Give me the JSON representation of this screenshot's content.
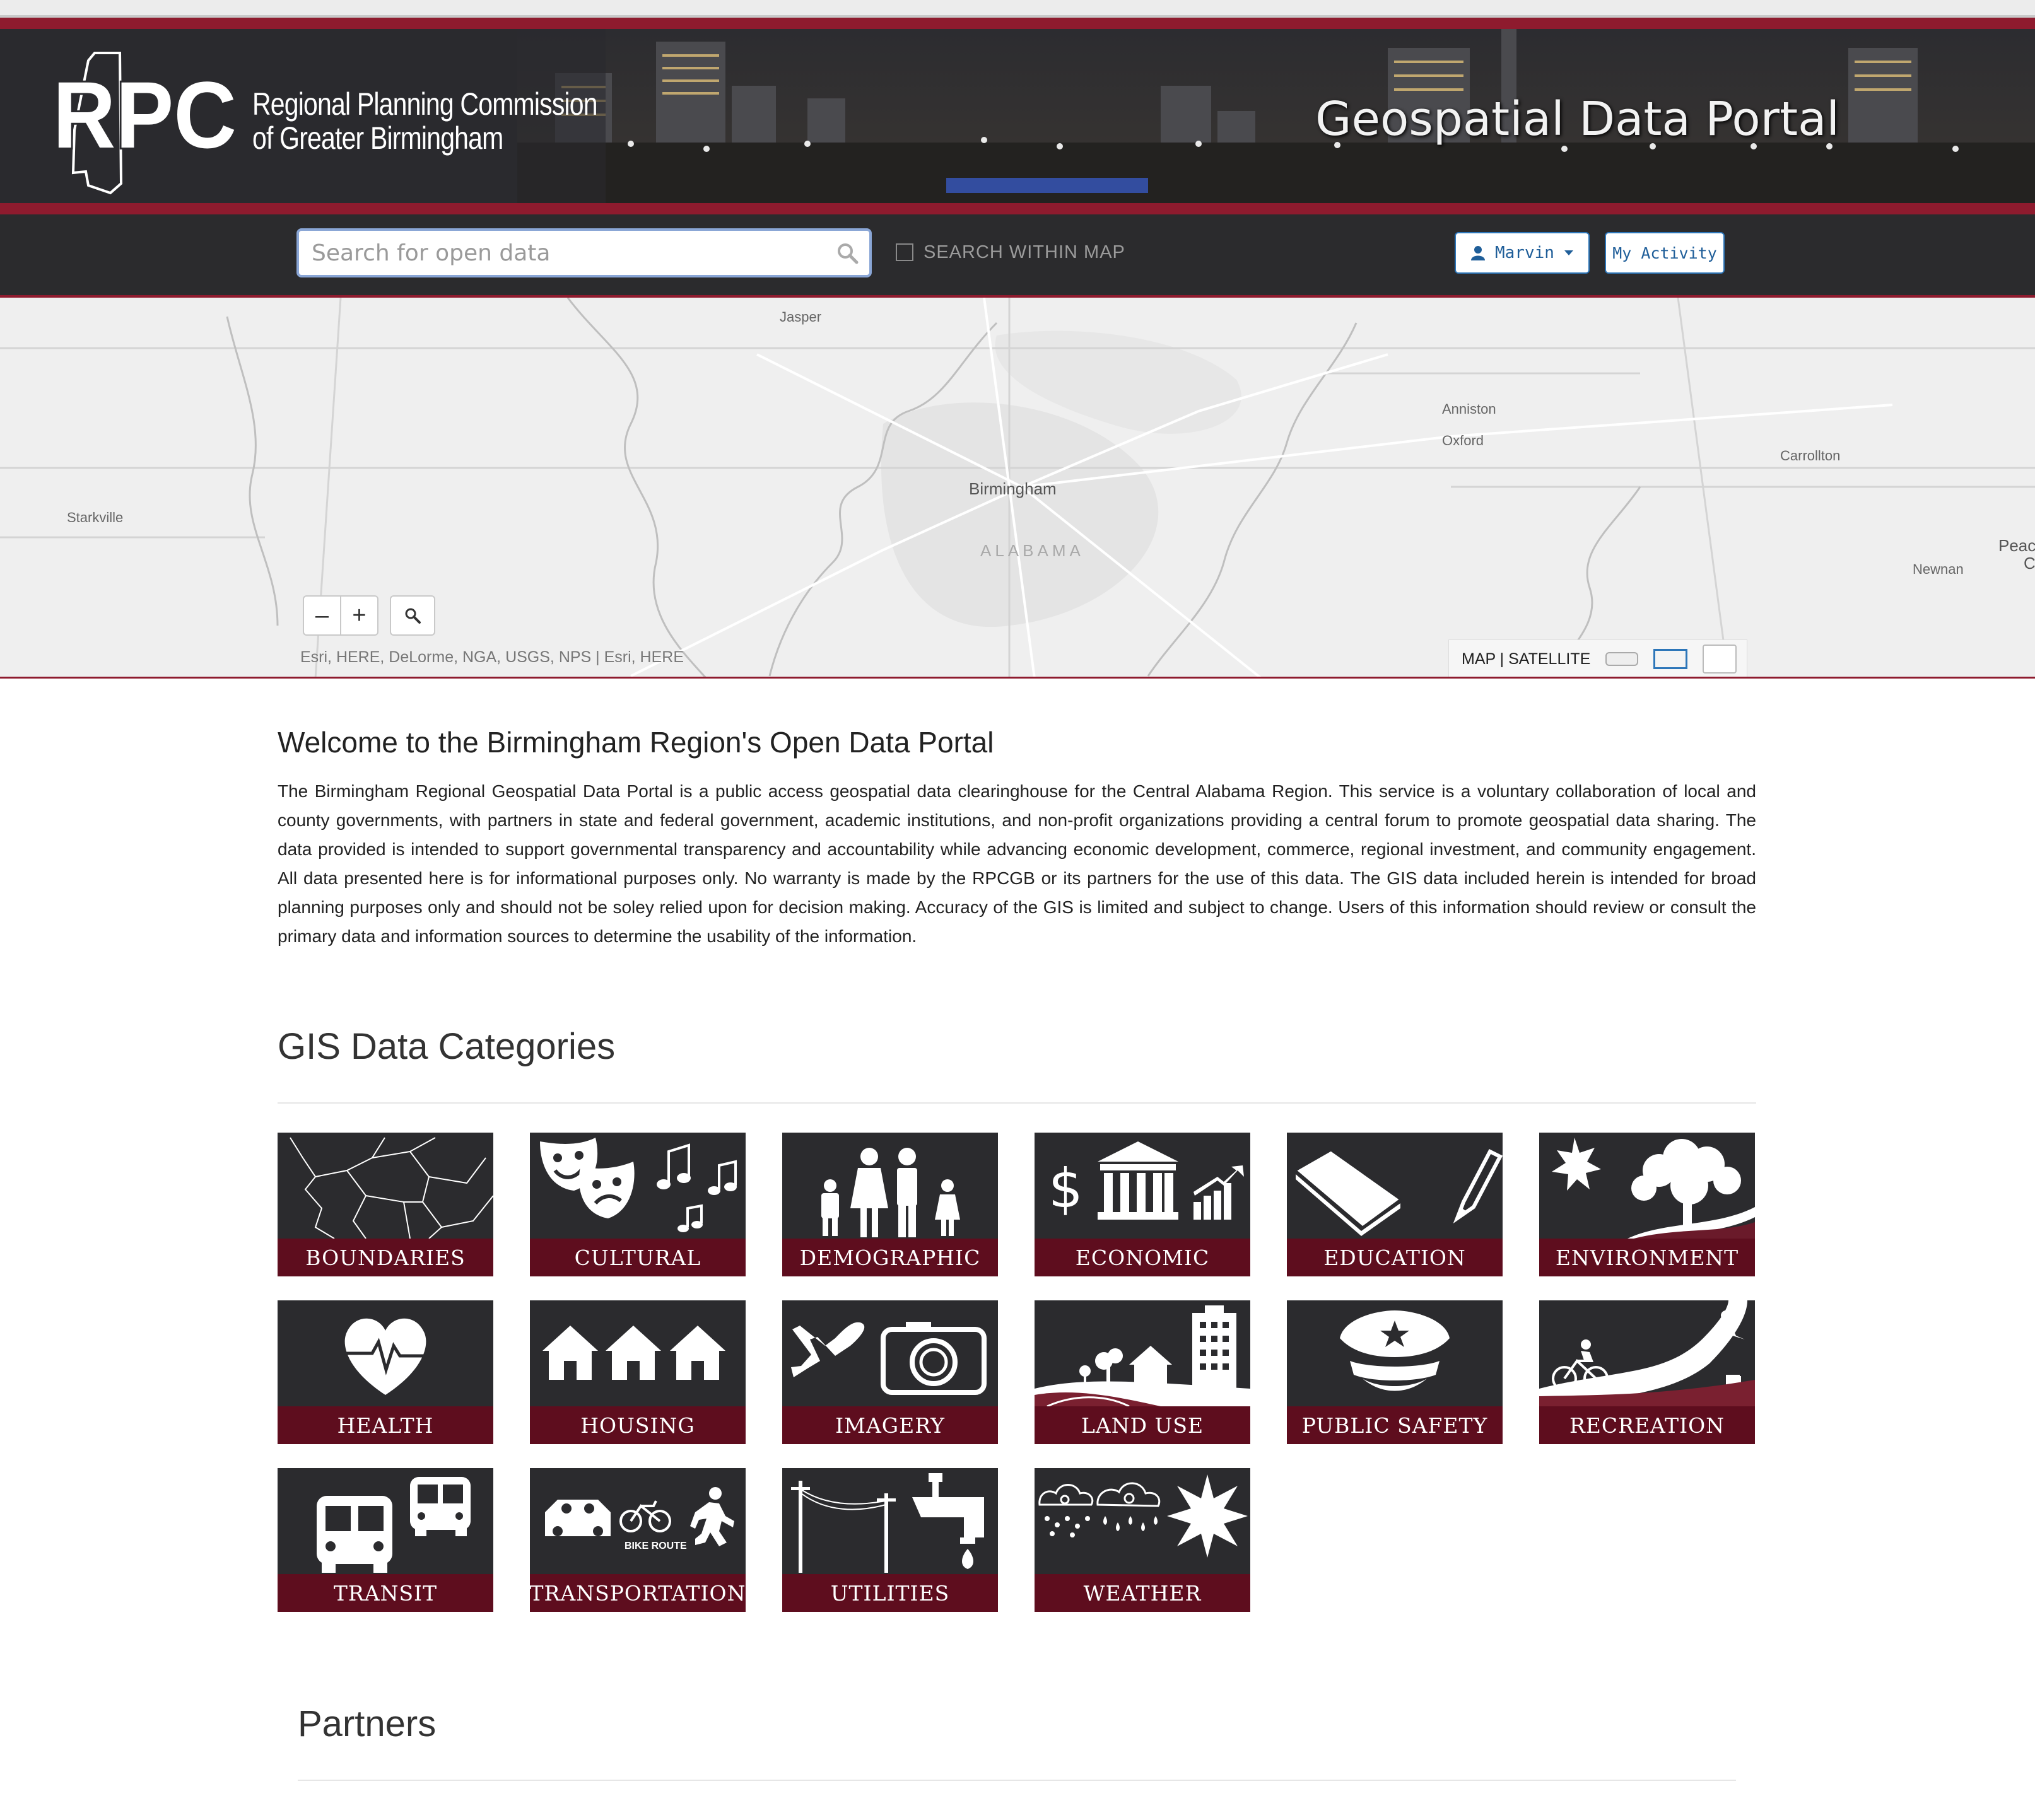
{
  "banner": {
    "logo_mark": "RPC",
    "org_line1": "Regional Planning Commission",
    "org_line2": "of Greater Birmingham",
    "portal_title": "Geospatial Data Portal"
  },
  "search": {
    "placeholder": "Search for open data",
    "within_map_label": "SEARCH WITHIN MAP",
    "user_label": "Marvin",
    "activity_label": "My Activity"
  },
  "map": {
    "labels": {
      "jasper": "Jasper",
      "anniston": "Anniston",
      "oxford": "Oxford",
      "carrollton": "Carrollton",
      "birmingham": "Birmingham",
      "alabama": "ALABAMA",
      "starkville": "Starkville",
      "newnan": "Newnan",
      "peachtree": "Peac",
      "peachtree2": "C"
    },
    "zoom_out": "–",
    "zoom_in": "+",
    "attribution": "Esri, HERE, DeLorme, NGA, USGS, NPS | Esri, HERE",
    "basemap_toggle": "MAP | SATELLITE"
  },
  "welcome": {
    "heading": "Welcome to the Birmingham Region's Open Data Portal",
    "body": "The Birmingham Regional Geospatial Data Portal is a public access geospatial data clearinghouse for the Central Alabama Region. This service is a voluntary collaboration of local and county governments, with partners in state and federal government, academic institutions, and non-profit organizations providing a central forum to promote geospatial data sharing. The data provided is intended to support governmental transparency and accountability while advancing economic development, commerce, regional investment, and community engagement. All data presented here is for informational purposes only. No warranty is made by the RPCGB or its partners for the use of this data. The GIS data included herein is intended for broad planning purposes only and should not be soley relied upon for decision making. Accuracy of the GIS is limited and subject to change. Users of this information should review or consult the primary data and information sources to determine the usability of the information."
  },
  "categories": {
    "heading": "GIS Data Categories",
    "items": [
      {
        "label": "BOUNDARIES",
        "icon": "boundaries-icon"
      },
      {
        "label": "CULTURAL",
        "icon": "cultural-icon"
      },
      {
        "label": "DEMOGRAPHIC",
        "icon": "demographic-icon"
      },
      {
        "label": "ECONOMIC",
        "icon": "economic-icon"
      },
      {
        "label": "EDUCATION",
        "icon": "education-icon"
      },
      {
        "label": "ENVIRONMENT",
        "icon": "environment-icon"
      },
      {
        "label": "HEALTH",
        "icon": "health-icon"
      },
      {
        "label": "HOUSING",
        "icon": "housing-icon"
      },
      {
        "label": "IMAGERY",
        "icon": "imagery-icon"
      },
      {
        "label": "LAND USE",
        "icon": "land-use-icon"
      },
      {
        "label": "PUBLIC SAFETY",
        "icon": "public-safety-icon"
      },
      {
        "label": "RECREATION",
        "icon": "recreation-icon"
      },
      {
        "label": "TRANSIT",
        "icon": "transit-icon"
      },
      {
        "label": "TRANSPORTATION",
        "icon": "transportation-icon",
        "sublabel": "BIKE ROUTE"
      },
      {
        "label": "UTILITIES",
        "icon": "utilities-icon"
      },
      {
        "label": "WEATHER",
        "icon": "weather-icon"
      }
    ]
  },
  "partners": {
    "heading": "Partners"
  },
  "colors": {
    "brand_maroon": "#8e1b2e",
    "tile_band": "#5e0d1e",
    "tile_bg": "#2b2b2e",
    "button_blue": "#2d76b9"
  }
}
